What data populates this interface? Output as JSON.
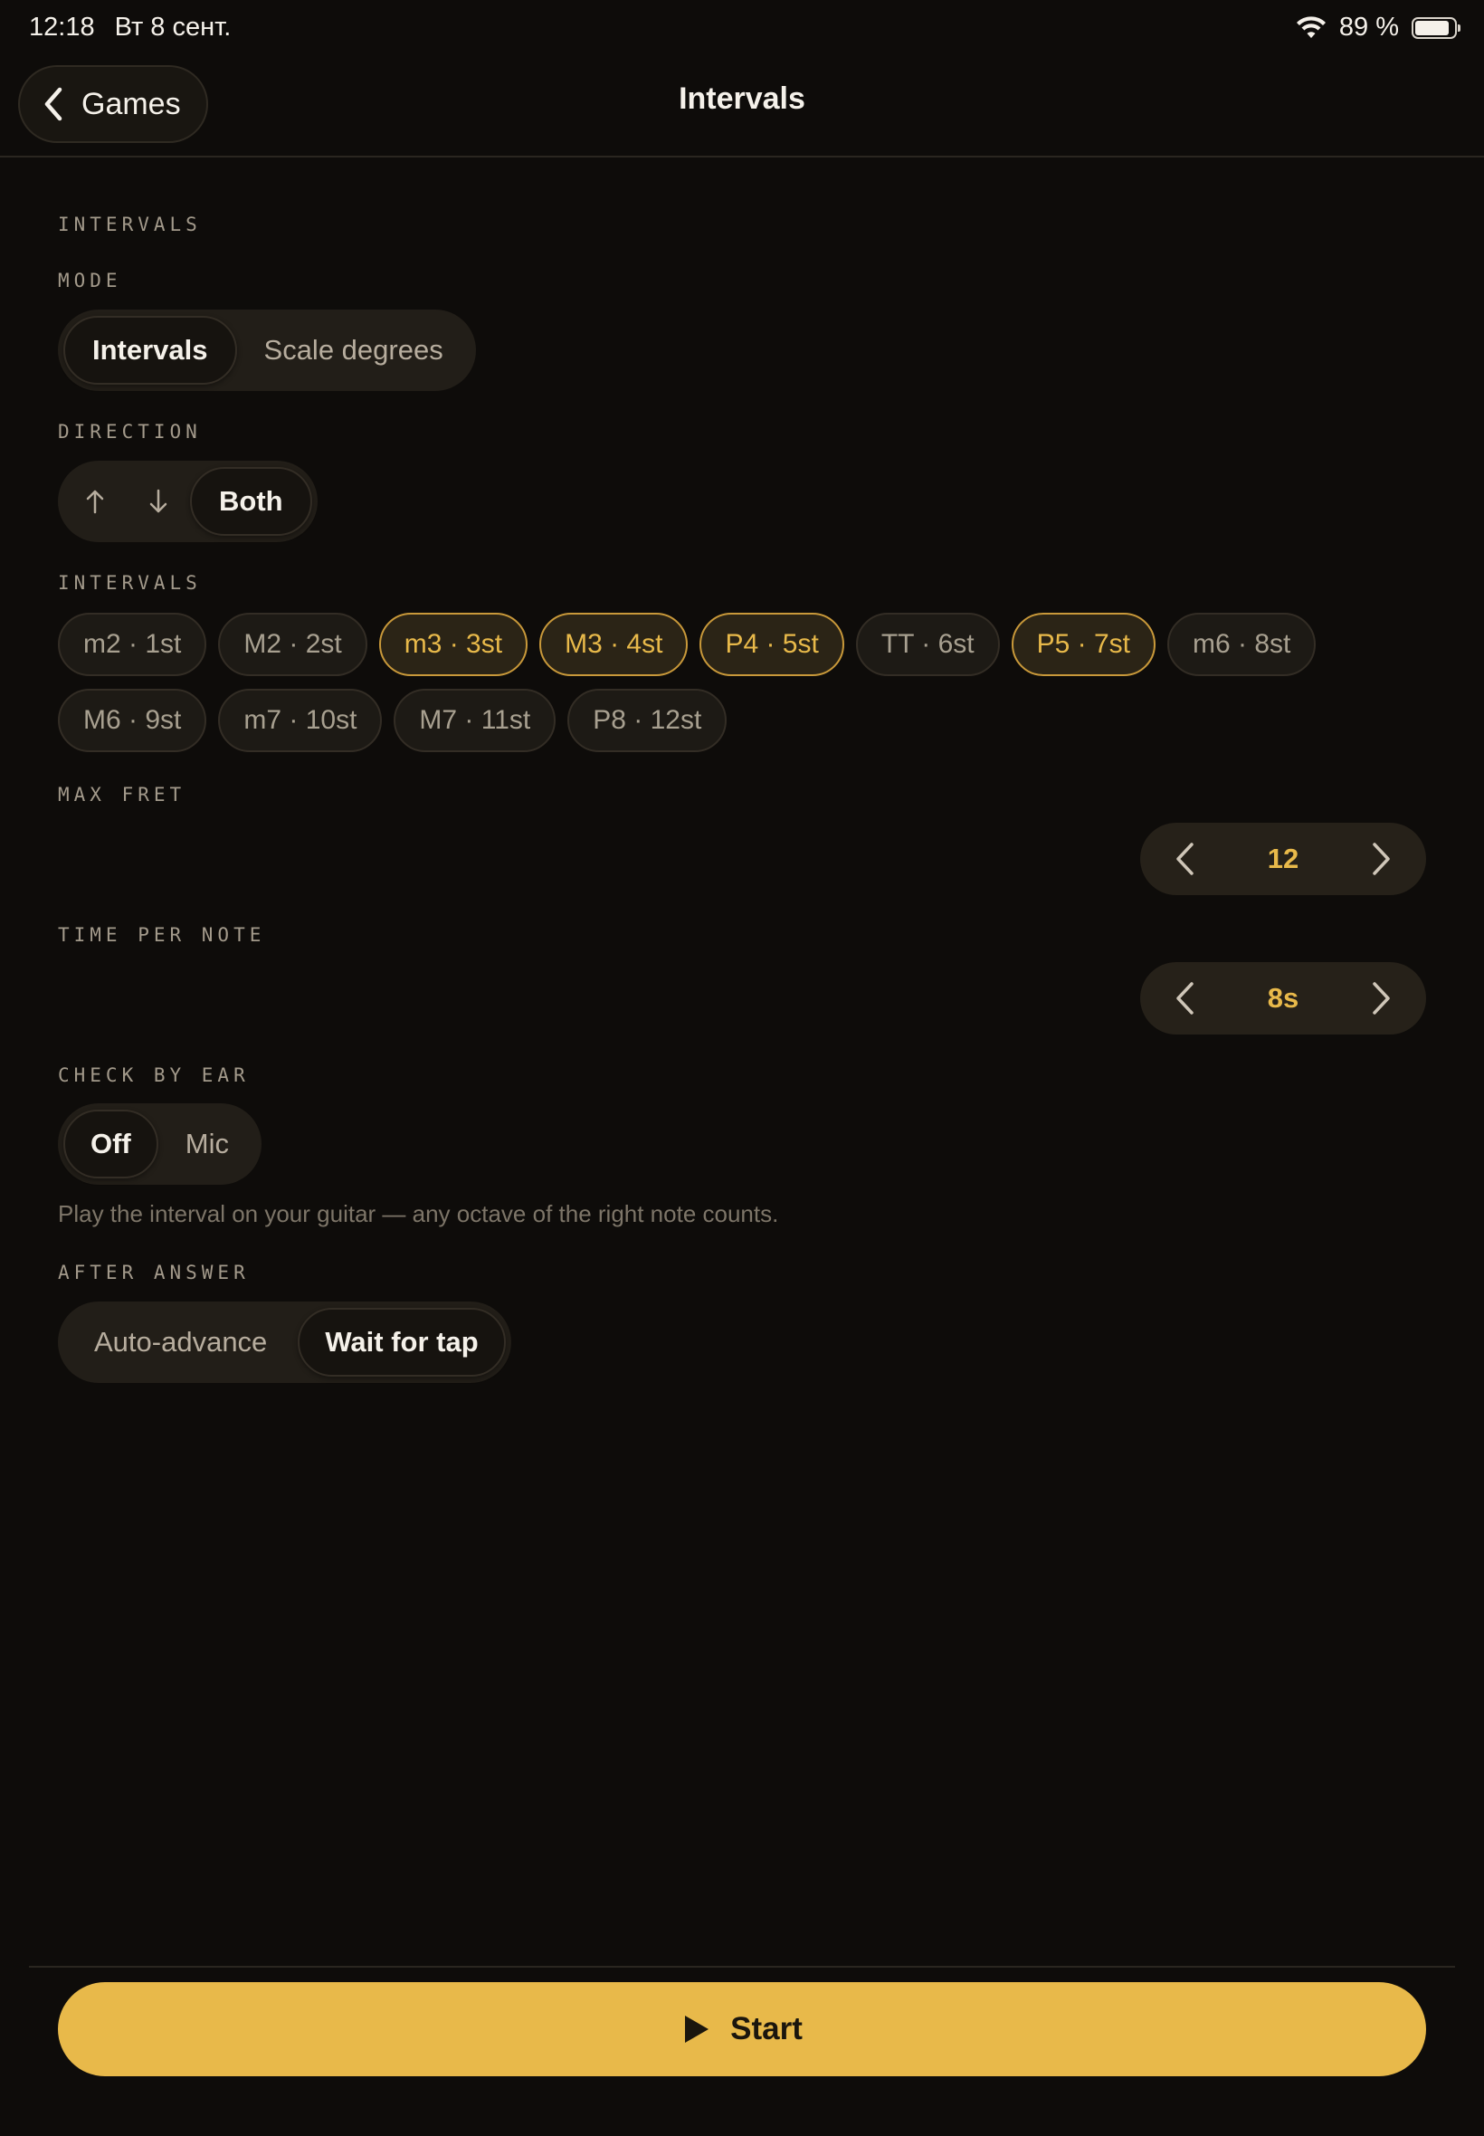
{
  "status_bar": {
    "time": "12:18",
    "date": "Вт 8 сент.",
    "battery_text": "89 %",
    "battery_level": 0.89
  },
  "nav": {
    "back_label": "Games",
    "title": "Intervals"
  },
  "section_header": "INTERVALS",
  "mode": {
    "label": "MODE",
    "options": [
      "Intervals",
      "Scale degrees"
    ],
    "selected": "Intervals"
  },
  "direction": {
    "label": "DIRECTION",
    "options": [
      "up-arrow-icon",
      "down-arrow-icon",
      "Both"
    ],
    "both_label": "Both",
    "selected": "Both"
  },
  "intervals": {
    "label": "INTERVALS",
    "chips": [
      {
        "text": "m2 · 1st",
        "on": false
      },
      {
        "text": "M2 · 2st",
        "on": false
      },
      {
        "text": "m3 · 3st",
        "on": true
      },
      {
        "text": "M3 · 4st",
        "on": true
      },
      {
        "text": "P4 · 5st",
        "on": true
      },
      {
        "text": "TT · 6st",
        "on": false
      },
      {
        "text": "P5 · 7st",
        "on": true
      },
      {
        "text": "m6 · 8st",
        "on": false
      },
      {
        "text": "M6 · 9st",
        "on": false
      },
      {
        "text": "m7 · 10st",
        "on": false
      },
      {
        "text": "M7 · 11st",
        "on": false
      },
      {
        "text": "P8 · 12st",
        "on": false
      }
    ]
  },
  "max_fret": {
    "label": "MAX FRET",
    "value": "12"
  },
  "time_per_note": {
    "label": "TIME PER NOTE",
    "value": "8s"
  },
  "check_by_ear": {
    "label": "CHECK BY EAR",
    "options": [
      "Off",
      "Mic"
    ],
    "selected": "Off",
    "hint": "Play the interval on your guitar — any octave of the right note counts."
  },
  "after_answer": {
    "label": "AFTER ANSWER",
    "options": [
      "Auto-advance",
      "Wait for tap"
    ],
    "selected": "Wait for tap"
  },
  "start": {
    "label": "Start"
  },
  "colors": {
    "accent": "#e8b94a",
    "background": "#0e0c0a"
  }
}
